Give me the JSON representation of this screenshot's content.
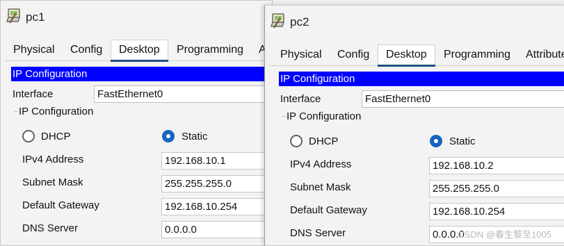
{
  "windows": [
    {
      "title": "pc1",
      "tabs": [
        {
          "label": "Physical",
          "active": false
        },
        {
          "label": "Config",
          "active": false
        },
        {
          "label": "Desktop",
          "active": true
        },
        {
          "label": "Programming",
          "active": false
        },
        {
          "label": "A",
          "active": false
        }
      ],
      "banner": "IP Configuration",
      "interface_label": "Interface",
      "interface_value": "FastEthernet0",
      "group_title": "IP Configuration",
      "dhcp_label": "DHCP",
      "static_label": "Static",
      "selected_mode": "Static",
      "fields": [
        {
          "label": "IPv4 Address",
          "value": "192.168.10.1"
        },
        {
          "label": "Subnet Mask",
          "value": "255.255.255.0"
        },
        {
          "label": "Default Gateway",
          "value": "192.168.10.254"
        },
        {
          "label": "DNS Server",
          "value": "0.0.0.0"
        }
      ]
    },
    {
      "title": "pc2",
      "tabs": [
        {
          "label": "Physical",
          "active": false
        },
        {
          "label": "Config",
          "active": false
        },
        {
          "label": "Desktop",
          "active": true
        },
        {
          "label": "Programming",
          "active": false
        },
        {
          "label": "Attribute",
          "active": false
        }
      ],
      "banner": "IP Configuration",
      "interface_label": "Interface",
      "interface_value": "FastEthernet0",
      "group_title": "IP Configuration",
      "dhcp_label": "DHCP",
      "static_label": "Static",
      "selected_mode": "Static",
      "fields": [
        {
          "label": "IPv4 Address",
          "value": "192.168.10.2"
        },
        {
          "label": "Subnet Mask",
          "value": "255.255.255.0"
        },
        {
          "label": "Default Gateway",
          "value": "192.168.10.254"
        },
        {
          "label": "DNS Server",
          "value": "0.0.0.0"
        }
      ]
    }
  ],
  "watermark": "CSDN @春生黎至1005",
  "colors": {
    "banner_bg": "#0000ff",
    "banner_text": "#ffffff",
    "radio_selected": "#1565c0",
    "tab_underline": "#1e4f80"
  }
}
